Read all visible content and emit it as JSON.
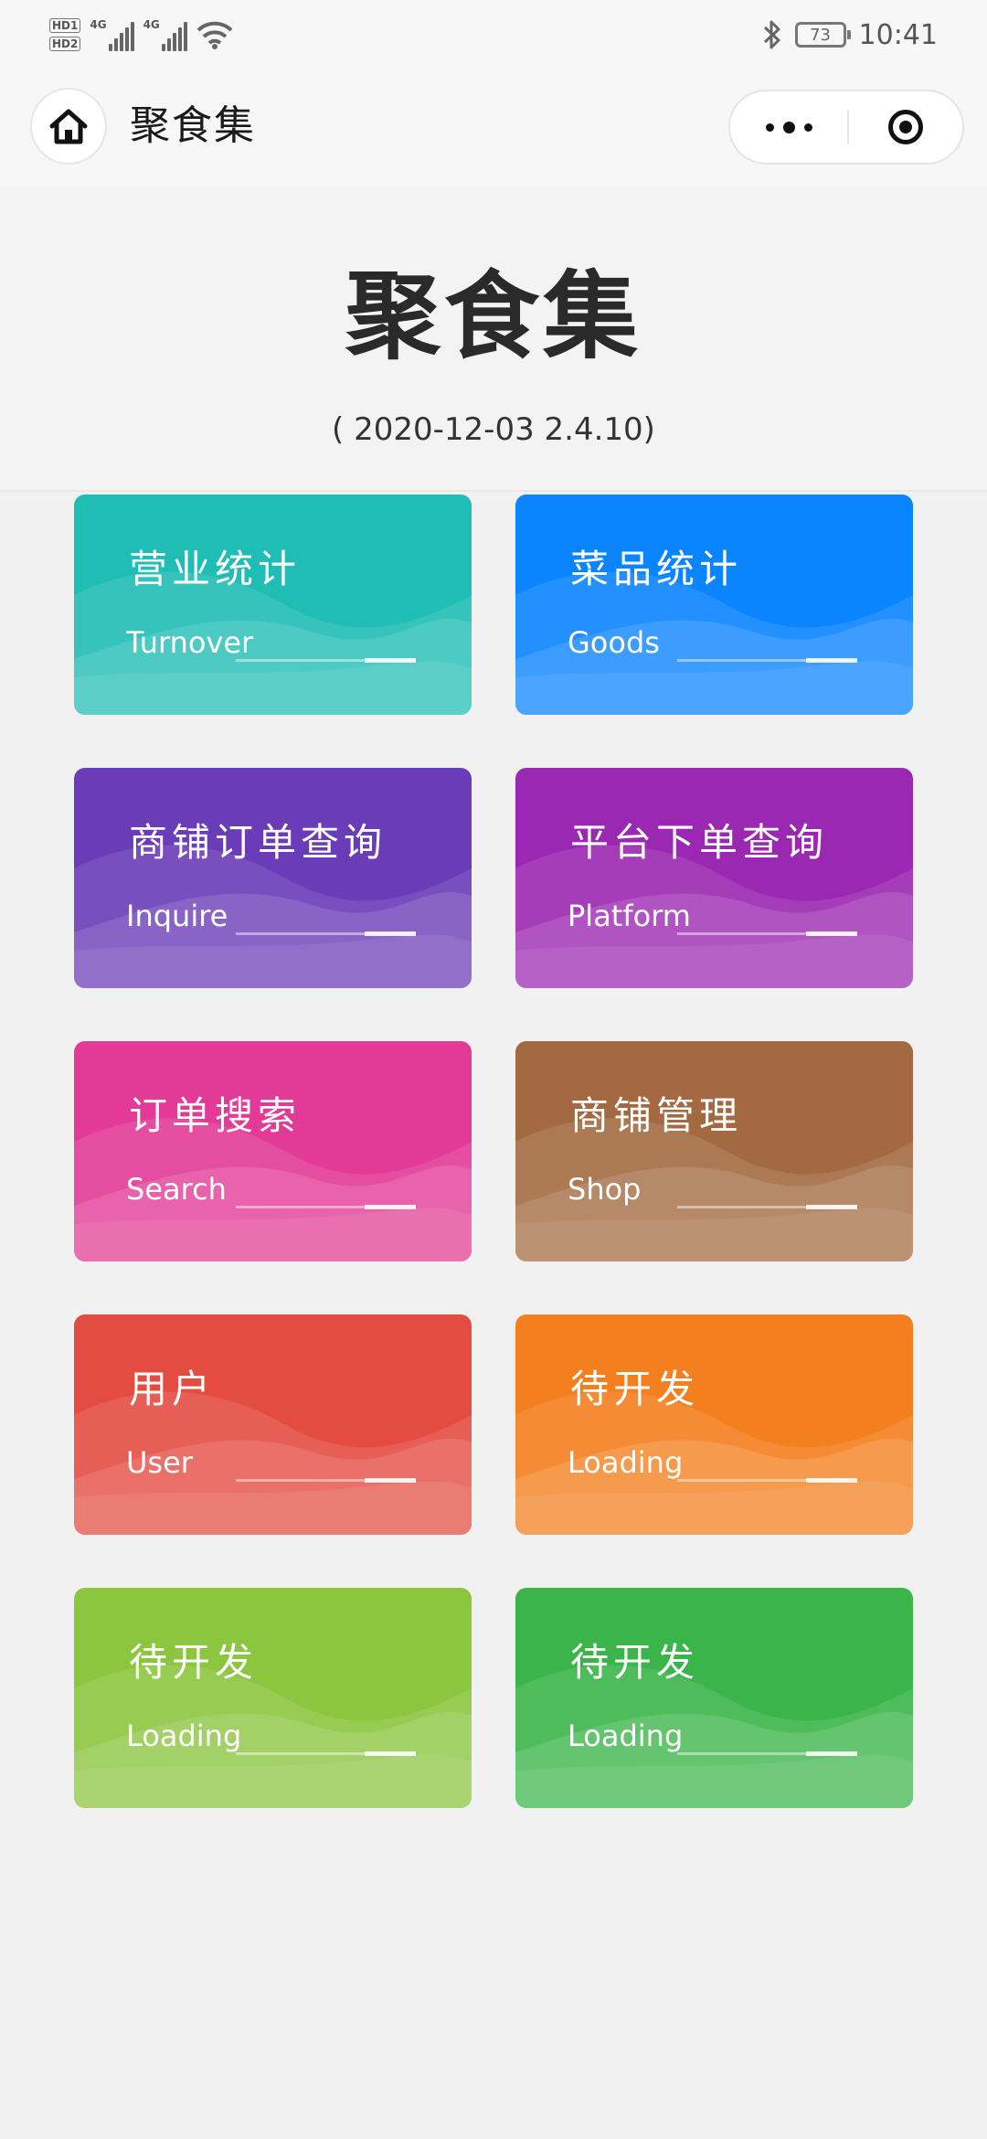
{
  "status_bar": {
    "hd1": "HD1",
    "hd2": "HD2",
    "net1": "4G",
    "net2": "4G",
    "battery": "73",
    "time": "10:41"
  },
  "title_bar": {
    "title": "聚食集"
  },
  "header": {
    "brand": "聚食集",
    "version": "( 2020-12-03 2.4.10)"
  },
  "cards": [
    {
      "title": "营业统计",
      "subtitle": "Turnover",
      "color": "#1fbdb4"
    },
    {
      "title": "菜品统计",
      "subtitle": "Goods",
      "color": "#0a84ff"
    },
    {
      "title": "商铺订单查询",
      "subtitle": "Inquire",
      "color": "#6a3cb8"
    },
    {
      "title": "平台下单查询",
      "subtitle": "Platform",
      "color": "#9b28b2"
    },
    {
      "title": "订单搜索",
      "subtitle": "Search",
      "color": "#e23a96"
    },
    {
      "title": "商铺管理",
      "subtitle": "Shop",
      "color": "#a36a42"
    },
    {
      "title": "用户",
      "subtitle": "User",
      "color": "#e44c42"
    },
    {
      "title": "待开发",
      "subtitle": "Loading",
      "color": "#f47f1f"
    },
    {
      "title": "待开发",
      "subtitle": "Loading",
      "color": "#8cc63f"
    },
    {
      "title": "待开发",
      "subtitle": "Loading",
      "color": "#3bb54a"
    }
  ]
}
